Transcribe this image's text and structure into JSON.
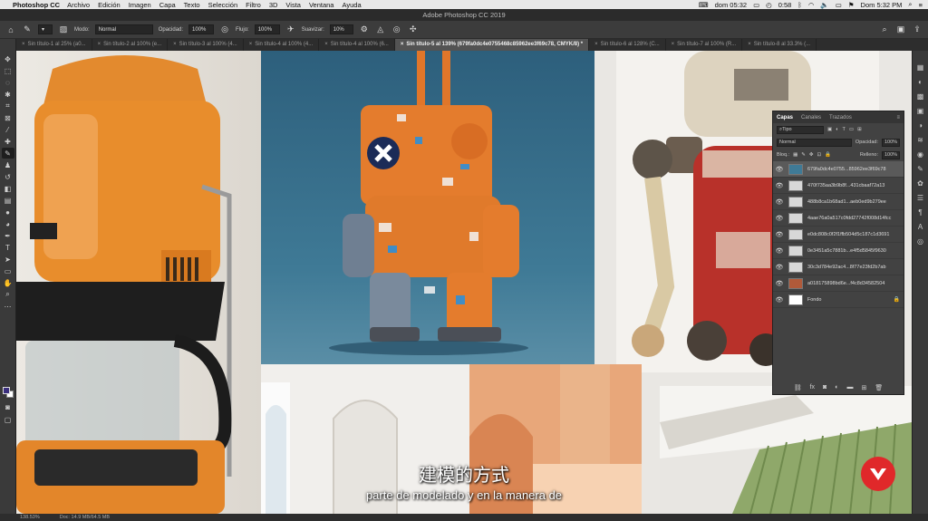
{
  "menubar": {
    "app_name": "Photoshop CC",
    "items": [
      "Archivo",
      "Edición",
      "Imagen",
      "Capa",
      "Texto",
      "Selección",
      "Filtro",
      "3D",
      "Vista",
      "Ventana",
      "Ayuda"
    ],
    "status_day": "dom 05:32",
    "status_battery": "0:58",
    "status_time": "Dom 5:32 PM"
  },
  "titlebar": {
    "title": "Adobe Photoshop CC 2019"
  },
  "options": {
    "mode_label": "Modo:",
    "mode_value": "Normal",
    "opacity_label": "Opacidad:",
    "opacity_value": "100%",
    "flow_label": "Flujo:",
    "flow_value": "100%",
    "smooth_label": "Suavizar:",
    "smooth_value": "10%"
  },
  "tabs": [
    "Sin título-1 al 25% (a0...",
    "Sin título-2 al 100% (e...",
    "Sin título-3 al 100% (4...",
    "Sin título-4 al 100% (4...",
    "Sin título-4 al 100% (6...",
    "Sin título-5 al 139% (679fa0dc4e0755468c85962ee3f69c78, CMYK/8) *",
    "Sin título-6 al 128% (C...",
    "Sin título-7 al 100% (R...",
    "Sin título-8 al 33.3% (..."
  ],
  "status": {
    "zoom": "138.53%",
    "doc": "Doc: 14.9 MB/64.5 MB"
  },
  "layers_panel": {
    "tabs": [
      "Capas",
      "Canales",
      "Trazados"
    ],
    "filter_kind": "Tipo",
    "blend_mode": "Normal",
    "opacity_label": "Opacidad:",
    "opacity_value": "100%",
    "lock_label": "Bloq.:",
    "fill_label": "Relleno:",
    "fill_value": "100%",
    "layers": [
      "679fa0dc4e0755...85962ee3f69c78",
      "470f735aa3b9b8f...431cbaaf72a13",
      "488b8ca1b68ad1...aeb0ed9b279ee",
      "4aae76a0a517c0fdd27742f008d14fcc",
      "e0dc808c0f2f1ffb504d5c187c1d3691",
      "0e3451a5c7881b...e4f5d5845f9630",
      "30c3d784e92ac4...8f77e23fd2b7ab",
      "a018175898bd6e...f4c8d34582504",
      "Fondo"
    ]
  },
  "subtitles": {
    "zh": "建模的方式",
    "es": "parte de modelado y en la manera de"
  },
  "colors": {
    "accent_brand": "#e0282a",
    "foreground_swatch": "#3b2f7e",
    "background_swatch": "#ffffff"
  }
}
